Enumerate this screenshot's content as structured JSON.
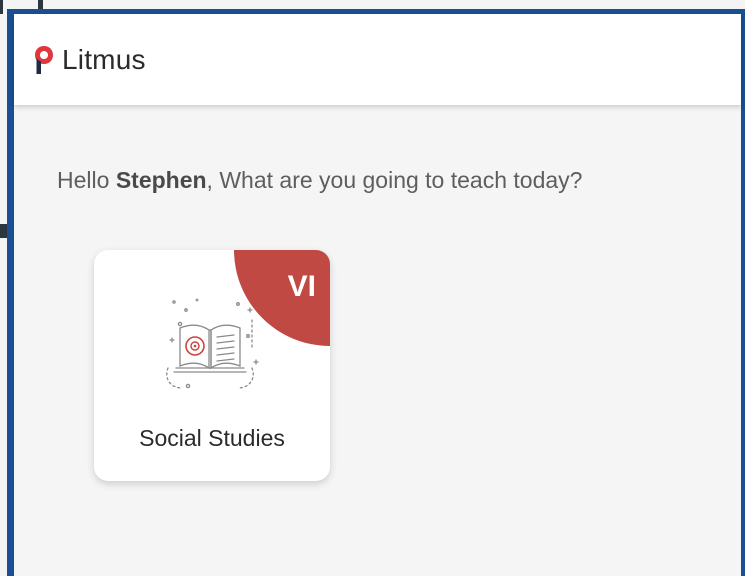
{
  "app": {
    "name": "Litmus",
    "brand_color": "#e0373c",
    "brand_color_dark": "#1f2a44"
  },
  "greeting": {
    "prefix": "Hello ",
    "user": "Stephen",
    "suffix": ", What are you going to teach today?"
  },
  "subjects": [
    {
      "name": "Social Studies",
      "grade": "VI",
      "badge_color": "#c04a43",
      "icon": "open-book-icon"
    }
  ]
}
